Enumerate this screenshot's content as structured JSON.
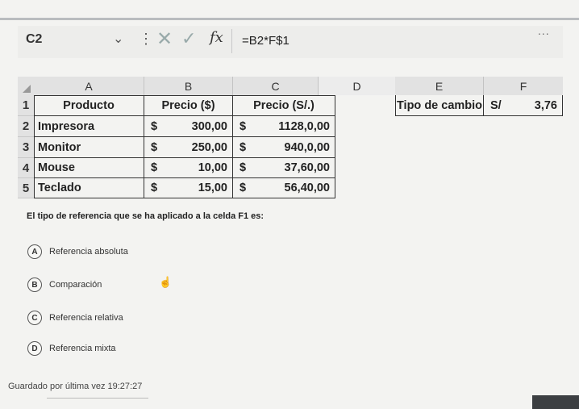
{
  "formula_bar": {
    "name_box": "C2",
    "fx": "fx",
    "formula": "=B2*F$1",
    "more": "..."
  },
  "sheet": {
    "columns": [
      "A",
      "B",
      "C",
      "D",
      "E",
      "F"
    ],
    "rows": [
      "1",
      "2",
      "3",
      "4",
      "5"
    ],
    "table": {
      "headers": [
        "Producto",
        "Precio ($)",
        "Precio (S/.)"
      ],
      "rows": [
        {
          "product": "Impresora",
          "usd_symbol": "$",
          "usd": "300,00",
          "pen_symbol": "$",
          "pen": "1128,0,00"
        },
        {
          "product": "Monitor",
          "usd_symbol": "$",
          "usd": "250,00",
          "pen_symbol": "$",
          "pen": "940,0,00"
        },
        {
          "product": "Mouse",
          "usd_symbol": "$",
          "usd": "10,00",
          "pen_symbol": "$",
          "pen": "37,60,00"
        },
        {
          "product": "Teclado",
          "usd_symbol": "$",
          "usd": "15,00",
          "pen_symbol": "$",
          "pen": "56,40,00"
        }
      ]
    },
    "exchange": {
      "label": "Tipo de cambio",
      "currency": "S/",
      "value": "3,76"
    }
  },
  "question": {
    "text": "El tipo de referencia que se ha aplicado a la celda F1 es:",
    "options": [
      {
        "letter": "A",
        "label": "Referencia absoluta"
      },
      {
        "letter": "B",
        "label": "Comparación"
      },
      {
        "letter": "C",
        "label": "Referencia relativa"
      },
      {
        "letter": "D",
        "label": "Referencia mixta"
      }
    ]
  },
  "footer": {
    "saved": "Guardado por última vez 19:27:27"
  }
}
